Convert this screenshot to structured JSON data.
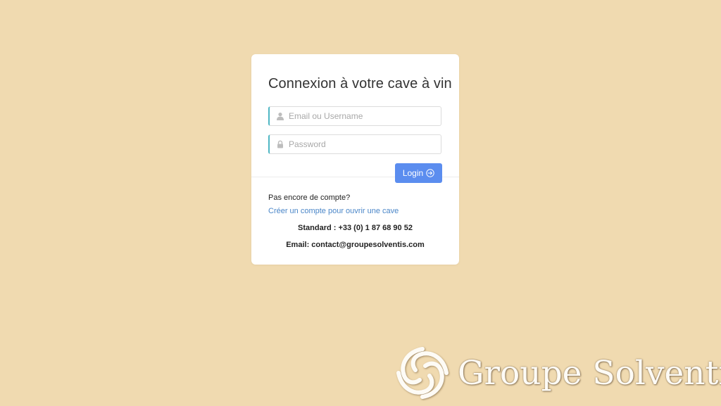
{
  "login_form": {
    "title": "Connexion à votre cave à vin",
    "email_field": {
      "placeholder": "Email ou Username",
      "value": "",
      "icon": "user-icon"
    },
    "password_field": {
      "placeholder": "Password",
      "value": "",
      "icon": "lock-icon"
    },
    "login_button": {
      "label": "Login",
      "icon": "arrow-right-circle-icon"
    },
    "no_account_text": "Pas encore de compte?",
    "create_account_link": "Créer un compte pour ouvrir une cave",
    "phone_text": "Standard : +33 (0) 1 87 68 90 52",
    "email_text": "Email: contact@groupesolventis.com"
  },
  "branding": {
    "name": "Groupe Solventis",
    "logo_icon": "solventis-logo-icon"
  },
  "colors": {
    "background": "#f0dab0",
    "card": "#ffffff",
    "field_accent": "#4fb7c4",
    "button": "#5b8def",
    "link": "#4a86c8"
  }
}
